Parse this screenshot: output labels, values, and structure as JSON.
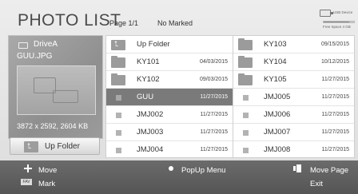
{
  "header": {
    "title": "PHOTO LIST",
    "page_info": "Page 1/1",
    "marked_info": "No Marked",
    "device": {
      "name": "USB Device",
      "free_space": "Free Space 4 GB",
      "icon": "usb-drive-icon",
      "usage_fraction": 0.85
    }
  },
  "preview": {
    "drive_label": "DriveA",
    "drive_icon": "drive-icon",
    "file_name": "GUU.JPG",
    "dimensions": "3872 x 2592, 2604 KB"
  },
  "up_folder_button": {
    "label": "Up Folder",
    "icon": "up-folder-icon"
  },
  "file_grid": {
    "left_column": [
      {
        "type": "up",
        "name": "Up Folder",
        "date": ""
      },
      {
        "type": "folder",
        "name": "KY101",
        "date": "04/03/2015"
      },
      {
        "type": "folder",
        "name": "KY102",
        "date": "09/03/2015"
      },
      {
        "type": "file",
        "name": "GUU",
        "date": "11/27/2015",
        "selected": true
      },
      {
        "type": "file",
        "name": "JMJ002",
        "date": "11/27/2015"
      },
      {
        "type": "file",
        "name": "JMJ003",
        "date": "11/27/2015"
      },
      {
        "type": "file",
        "name": "JMJ004",
        "date": "11/27/2015"
      }
    ],
    "right_column": [
      {
        "type": "folder",
        "name": "KY103",
        "date": "09/15/2015"
      },
      {
        "type": "folder",
        "name": "KY104",
        "date": "10/12/2015"
      },
      {
        "type": "folder",
        "name": "KY105",
        "date": "11/27/2015"
      },
      {
        "type": "file",
        "name": "JMJ005",
        "date": "11/27/2015"
      },
      {
        "type": "file",
        "name": "JMJ006",
        "date": "11/27/2015"
      },
      {
        "type": "file",
        "name": "JMJ007",
        "date": "11/27/2015"
      },
      {
        "type": "file",
        "name": "JMJ008",
        "date": "11/27/2015"
      }
    ]
  },
  "footer": {
    "move_label": "Move",
    "mark_label": "Mark",
    "fav_key": "FAV",
    "popup_label": "PopUp Menu",
    "move_page_label": "Move Page",
    "exit_label": "Exit"
  },
  "colors": {
    "selected_row": "#7a7a7a",
    "footer": "#5e5e5e",
    "icon_gray": "#9b9b9b"
  }
}
